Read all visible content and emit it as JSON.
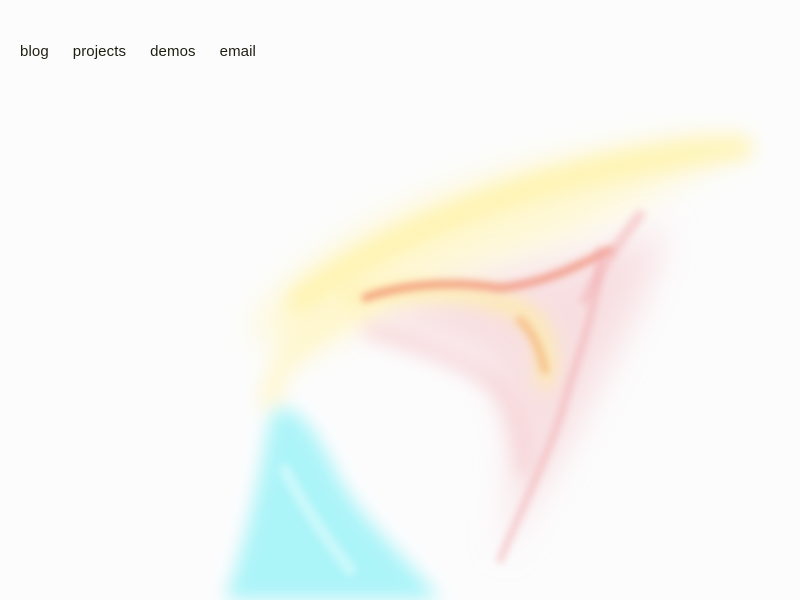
{
  "nav": {
    "items": [
      {
        "label": "blog"
      },
      {
        "label": "projects"
      },
      {
        "label": "demos"
      },
      {
        "label": "email"
      }
    ]
  },
  "background": {
    "base_color": "#fcfcfd",
    "artwork": "abstract-fluid-smoke",
    "colors": [
      "#fff3a6",
      "#f07a5c",
      "#f2b3b8",
      "#9af3f7"
    ]
  }
}
